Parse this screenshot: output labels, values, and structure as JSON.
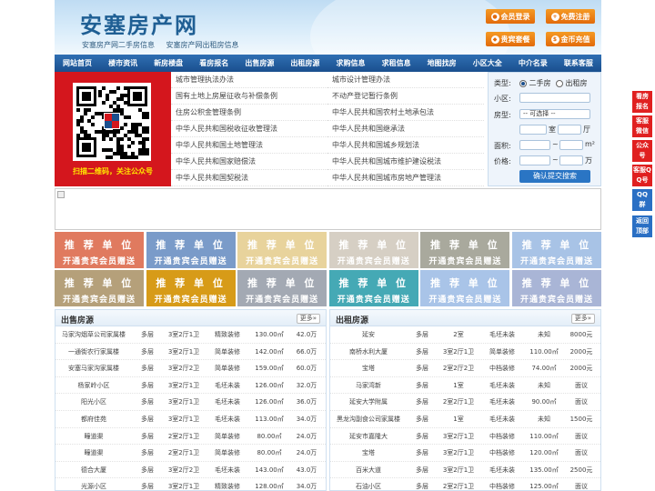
{
  "header": {
    "title": "安塞房产网",
    "subtitle_links": [
      "安塞房产网二手房信息",
      "安塞房产网出租房信息"
    ],
    "buttons": [
      {
        "label": "会员登录",
        "icon": "user-icon"
      },
      {
        "label": "免费注册",
        "icon": "user-add-icon"
      },
      {
        "label": "贵宾套餐",
        "icon": "diamond-icon"
      },
      {
        "label": "金币充值",
        "icon": "coin-icon"
      }
    ]
  },
  "nav": [
    "网站首页",
    "楼市资讯",
    "新房楼盘",
    "看房报名",
    "出售房源",
    "出租房源",
    "求购信息",
    "求租信息",
    "地图找房",
    "小区大全",
    "中介名录",
    "联系客服"
  ],
  "qr_caption": "扫描二维码，关注公众号",
  "news_left": [
    "城市管理执法办法",
    "国有土地上房屋征收与补偿条例",
    "住房公积金管理条例",
    "中华人民共和国税收征收管理法",
    "中华人民共和国土地管理法",
    "中华人民共和国家赔偿法",
    "中华人民共和国契税法"
  ],
  "news_right": [
    "城市设计管理办法",
    "不动产登记暂行条例",
    "中华人民共和国农村土地承包法",
    "中华人民共和国继承法",
    "中华人民共和国城乡规划法",
    "中华人民共和国城市维护建设税法",
    "中华人民共和国城市房地产管理法"
  ],
  "search": {
    "type_label": "类型:",
    "option_secondhand": "二手房",
    "option_rental": "出租房",
    "community_label": "小区:",
    "house_type_label": "房型:",
    "house_type_select": "-- 可选择 --",
    "room_unit": "室",
    "hall_unit": "厅",
    "area_label": "面积:",
    "area_unit": "m²",
    "price_label": "价格:",
    "range_sep": "~",
    "price_unit": "万",
    "submit_label": "确认提交搜索"
  },
  "recommend": {
    "title": "推 荐 单 位",
    "subtitle": "开通贵宾会员赠送",
    "colors": [
      "#e07a5f",
      "#7a9bc9",
      "#e8d39c",
      "#d6cfc4",
      "#a9a99d",
      "#a8c3e6",
      "#b5a07a",
      "#d79b18",
      "#a3a9b3",
      "#45a9b5",
      "#a9c4e8",
      "#a9b5d6"
    ]
  },
  "sale": {
    "title": "出售房源",
    "more": "更多»",
    "rows": [
      [
        "马家沟烟草公司家属楼",
        "多层",
        "3室2厅1卫",
        "精致装修",
        "130.00㎡",
        "42.0万"
      ],
      [
        "一通街农行家属楼",
        "多层",
        "3室2厅1卫",
        "简单装修",
        "142.00㎡",
        "66.0万"
      ],
      [
        "安塞马家沟家属楼",
        "多层",
        "3室2厅2卫",
        "简单装修",
        "159.00㎡",
        "60.0万"
      ],
      [
        "杨家岭小区",
        "多层",
        "3室2厅1卫",
        "毛坯未装",
        "126.00㎡",
        "32.0万"
      ],
      [
        "阳光小区",
        "多层",
        "3室2厅1卫",
        "毛坯未装",
        "126.00㎡",
        "36.0万"
      ],
      [
        "都府佳苑",
        "多层",
        "3室2厅1卫",
        "毛坯未装",
        "113.00㎡",
        "34.0万"
      ],
      [
        "疃道渠",
        "多层",
        "2室2厅1卫",
        "简单装修",
        "80.00㎡",
        "24.0万"
      ],
      [
        "疃道渠",
        "多层",
        "2室2厅1卫",
        "简单装修",
        "80.00㎡",
        "24.0万"
      ],
      [
        "德合大厦",
        "多层",
        "3室2厅2卫",
        "毛坯未装",
        "143.00㎡",
        "43.0万"
      ],
      [
        "光源小区",
        "多层",
        "3室2厅1卫",
        "精致装修",
        "128.00㎡",
        "34.0万"
      ]
    ]
  },
  "rent": {
    "title": "出租房源",
    "more": "更多»",
    "rows": [
      [
        "延安",
        "多层",
        "2室",
        "毛坯未装",
        "未知",
        "8000元"
      ],
      [
        "南桥水利大厦",
        "多层",
        "3室2厅1卫",
        "简单装修",
        "110.00㎡",
        "2000元"
      ],
      [
        "宝塔",
        "多层",
        "2室2厅2卫",
        "中档装修",
        "74.00㎡",
        "2000元"
      ],
      [
        "马家湾新",
        "多层",
        "1室",
        "毛坯未装",
        "未知",
        "面议"
      ],
      [
        "延安大学附属",
        "多层",
        "2室2厅1卫",
        "毛坯未装",
        "90.00㎡",
        "面议"
      ],
      [
        "黑龙沟副食公司家属楼",
        "多层",
        "1室",
        "毛坯未装",
        "未知",
        "1500元"
      ],
      [
        "延安市嘉隆大",
        "多层",
        "3室2厅1卫",
        "中档装修",
        "110.00㎡",
        "面议"
      ],
      [
        "宝塔",
        "多层",
        "3室2厅1卫",
        "中档装修",
        "120.00㎡",
        "面议"
      ],
      [
        "百米大道",
        "多层",
        "3室2厅1卫",
        "毛坯未装",
        "135.00㎡",
        "2500元"
      ],
      [
        "石油小区",
        "多层",
        "2室2厅1卫",
        "中档装修",
        "125.00㎡",
        "面议"
      ]
    ]
  },
  "side_tabs": [
    {
      "label": "看房报名",
      "color": "#e02020"
    },
    {
      "label": "客服微信",
      "color": "#e02020"
    },
    {
      "label": "公众号",
      "color": "#e02020"
    },
    {
      "label": "客服QQ号",
      "color": "#e02020"
    },
    {
      "label": "QQ群",
      "color": "#2a6fc4"
    },
    {
      "label": "返回顶部",
      "color": "#2a6fc4"
    }
  ]
}
